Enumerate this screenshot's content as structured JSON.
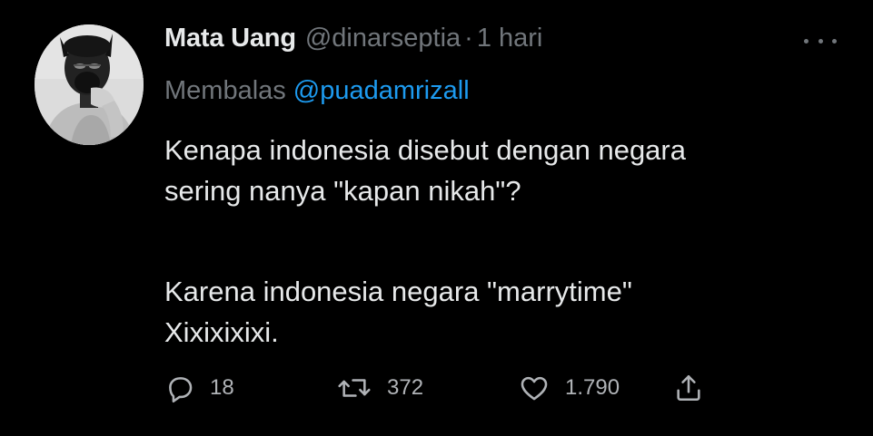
{
  "tweet": {
    "author_name": "Mata Uang",
    "author_handle": "@dinarseptia",
    "separator": "·",
    "time": "1 hari",
    "reply_prefix": "Membalas",
    "reply_to": "@puadamrizall",
    "body_line_1": "Kenapa indonesia disebut dengan negara",
    "body_line_2": "sering nanya \"kapan nikah\"?",
    "body_line_3": "Karena indonesia negara \"marrytime\"",
    "body_line_4": "Xixixixixi.",
    "replies": "18",
    "retweets": "372",
    "likes": "1.790"
  },
  "icons": {
    "more": "more-horizontal-icon",
    "reply": "speech-bubble-icon",
    "retweet": "retweet-arrows-icon",
    "like": "heart-outline-icon",
    "share": "share-upload-icon"
  },
  "colors": {
    "background": "#000000",
    "text_primary": "#e7e9ea",
    "text_secondary": "#71767b",
    "mention": "#1d9bf0"
  }
}
